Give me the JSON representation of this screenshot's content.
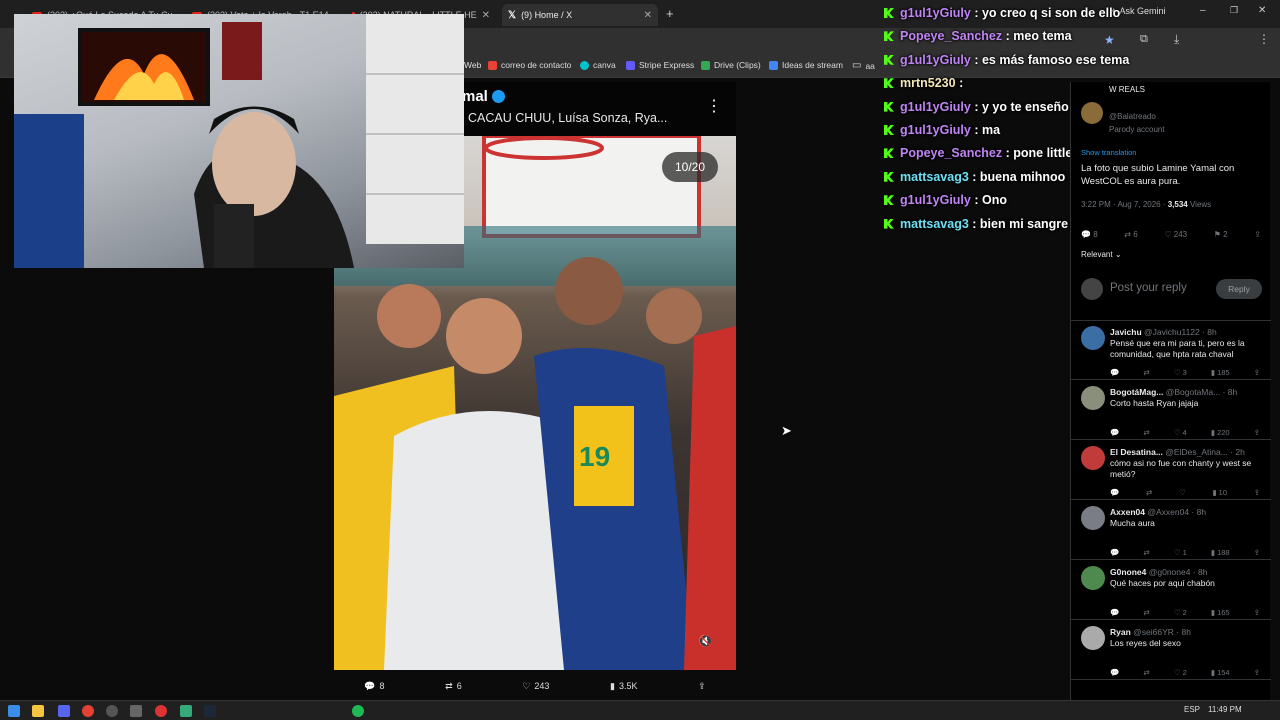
{
  "browser": {
    "tabs": [
      {
        "label": "(202) ¿Qué Le Sucede A Tu Cu",
        "icon": "youtube-icon"
      },
      {
        "label": "(202) Veta + la Vereb - T1 E14",
        "icon": "youtube-icon"
      },
      {
        "label": "(202) NATURAL - LITTLE HE",
        "icon": "youtube-icon"
      },
      {
        "label": "(9) Home / X",
        "icon": "x-icon"
      }
    ],
    "ask_gemini": "Ask Gemini",
    "bookmarks": [
      "Web",
      "correo de contacto",
      "canva",
      "Stripe Express",
      "Drive (Clips)",
      "Ideas de stream",
      "aa"
    ]
  },
  "media": {
    "title": "mal",
    "subtitle": "CACAU CHUU, Luísa Sonza, Rya...",
    "counter": "10/20",
    "actions": {
      "replies": "8",
      "reposts": "6",
      "likes": "243",
      "views": "3.5K"
    }
  },
  "chat": [
    {
      "user": "g1ul1yGiuly",
      "color": "#c085f5",
      "msg": "yo creo q si son de ello"
    },
    {
      "user": "Popeye_Sanchez",
      "color": "#c085f5",
      "msg": "meo tema"
    },
    {
      "user": "g1ul1yGiuly",
      "color": "#c085f5",
      "msg": "es más famoso ese tema"
    },
    {
      "user": "mrtn5230",
      "color": "#f5e6b8",
      "msg": ""
    },
    {
      "user": "g1ul1yGiuly",
      "color": "#c085f5",
      "msg": "y yo te enseño mil manera de singa na"
    },
    {
      "user": "g1ul1yGiuly",
      "color": "#c085f5",
      "msg": "ma"
    },
    {
      "user": "Popeye_Sanchez",
      "color": "#c085f5",
      "msg": "pone little home"
    },
    {
      "user": "mattsavag3",
      "color": "#6ee0f5",
      "msg": "buena mihnoo"
    },
    {
      "user": "g1ul1yGiuly",
      "color": "#c085f5",
      "msg": "Ono"
    },
    {
      "user": "mattsavag3",
      "color": "#6ee0f5",
      "msg": "bien mi sangre llegando a casita"
    }
  ],
  "tweet": {
    "header": "W REALS",
    "handle": "@Balatreado",
    "parody": "Parody account",
    "translation": "Show translation",
    "text": "La foto que subio Lamine Yamal con WestCOL es aura pura.",
    "meta": "3:22 PM · Aug 7, 2026 · ",
    "views": "3,534",
    "views_label": " Views",
    "stats": {
      "replies": "8",
      "reposts": "6",
      "likes": "243",
      "bookmarks": "2"
    },
    "sort": "Relevant",
    "reply_placeholder": "Post your reply",
    "reply_button": "Reply"
  },
  "replies": [
    {
      "name": "Javichu",
      "handle": "@Javichu1122 · 8h",
      "text": "Pensé que era mi para ti, pero es la comunidad, que hpta rata chaval",
      "likes": "3",
      "views": "185",
      "color": "#3a6ea5"
    },
    {
      "name": "BogotáMag...",
      "handle": "@BogotaMa... · 8h",
      "text": "Corto hasta Ryan jajaja",
      "likes": "4",
      "views": "220",
      "color": "#8a8f7c"
    },
    {
      "name": "El Desatina...",
      "handle": "@ElDes_Atina... · 2h",
      "text": "cómo asi no fue con chanty y west se metió?",
      "likes": "",
      "views": "10",
      "color": "#c23b3b"
    },
    {
      "name": "Axxen04",
      "handle": "@Axxen04 · 8h",
      "text": "Mucha aura",
      "likes": "1",
      "views": "188",
      "color": "#7a7d85"
    },
    {
      "name": "G0none4",
      "handle": "@g0none4 · 8h",
      "text": "Qué haces por aquí chabón",
      "likes": "2",
      "views": "165",
      "color": "#4e8a4e"
    },
    {
      "name": "Ryan",
      "handle": "@sei66YR · 8h",
      "text": "Los reyes del sexo",
      "likes": "2",
      "views": "154",
      "color": "#aaa"
    }
  ],
  "taskbar": {
    "lang": "ESP",
    "time": "11:49 PM"
  }
}
